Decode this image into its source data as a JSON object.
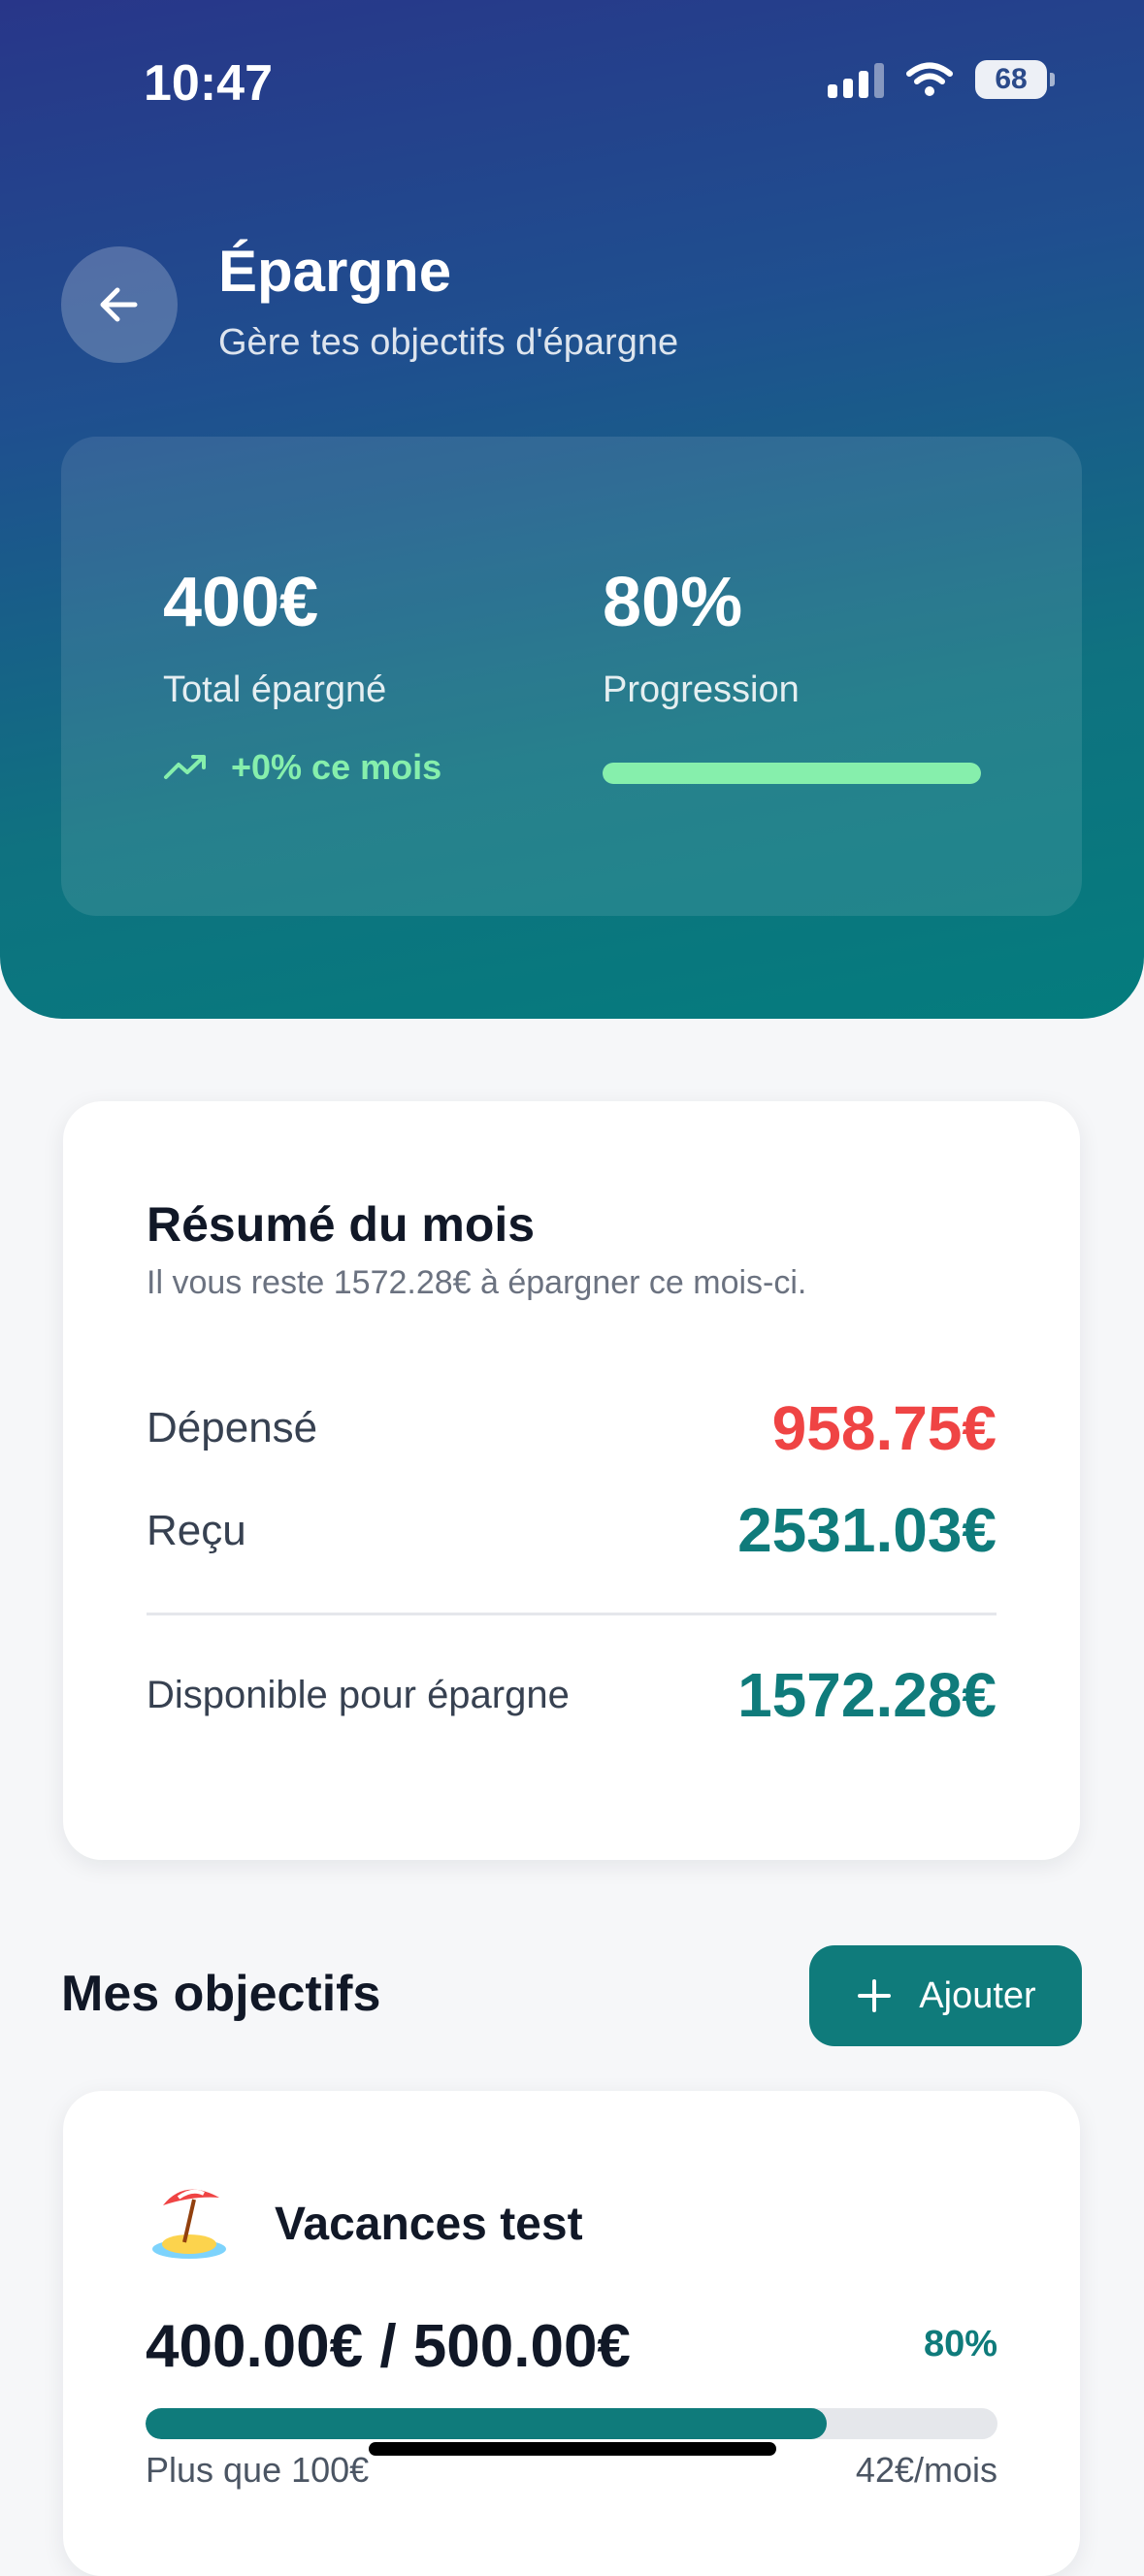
{
  "status_bar": {
    "time": "10:47",
    "battery": "68"
  },
  "header": {
    "title": "Épargne",
    "subtitle": "Gère tes objectifs d'épargne"
  },
  "stats": {
    "total_value": "400€",
    "total_label": "Total épargné",
    "trend": "+0% ce mois",
    "progress_value": "80%",
    "progress_label": "Progression",
    "progress_fraction": 1.0
  },
  "summary": {
    "title": "Résumé du mois",
    "note": "Il vous reste 1572.28€ à épargner ce mois-ci.",
    "spent_label": "Dépensé",
    "spent_value": "958.75€",
    "received_label": "Reçu",
    "received_value": "2531.03€",
    "available_label": "Disponible pour épargne",
    "available_value": "1572.28€"
  },
  "goals_section": {
    "title": "Mes objectifs",
    "add_label": "Ajouter"
  },
  "goals": [
    {
      "emoji": "🏝️",
      "name": "Vacances test",
      "amount": "400.00€ / 500.00€",
      "percent": "80%",
      "progress_fraction": 0.8,
      "min_note": "Plus que 100€",
      "monthly": "42€/mois"
    }
  ],
  "colors": {
    "accent": "#0f7b7b",
    "spent": "#ef4444",
    "positive": "#86efac",
    "header_gradient_start": "#283689",
    "header_gradient_end": "#047c7d"
  }
}
